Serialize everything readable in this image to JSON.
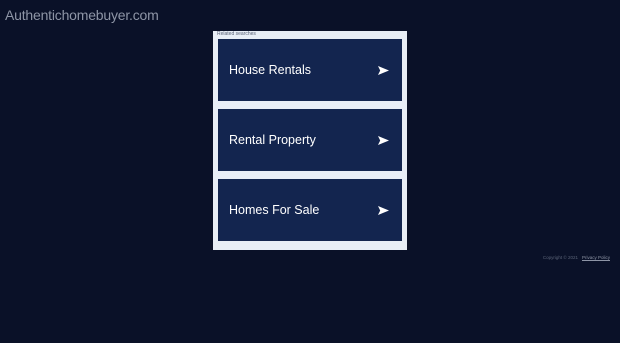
{
  "site": {
    "title": "Authentichomebuyer.com"
  },
  "related": {
    "caption": "Related searches",
    "items": [
      {
        "label": "House Rentals",
        "icon": "arrow-right-icon"
      },
      {
        "label": "Rental Property",
        "icon": "arrow-right-icon"
      },
      {
        "label": "Homes For Sale",
        "icon": "arrow-right-icon"
      }
    ]
  },
  "footer": {
    "copyright": "Copyright © 2021",
    "privacy_label": "Privacy Policy"
  },
  "colors": {
    "background": "#0a1128",
    "panel": "#e8eef6",
    "item": "#13254f",
    "item_text": "#ffffff"
  }
}
